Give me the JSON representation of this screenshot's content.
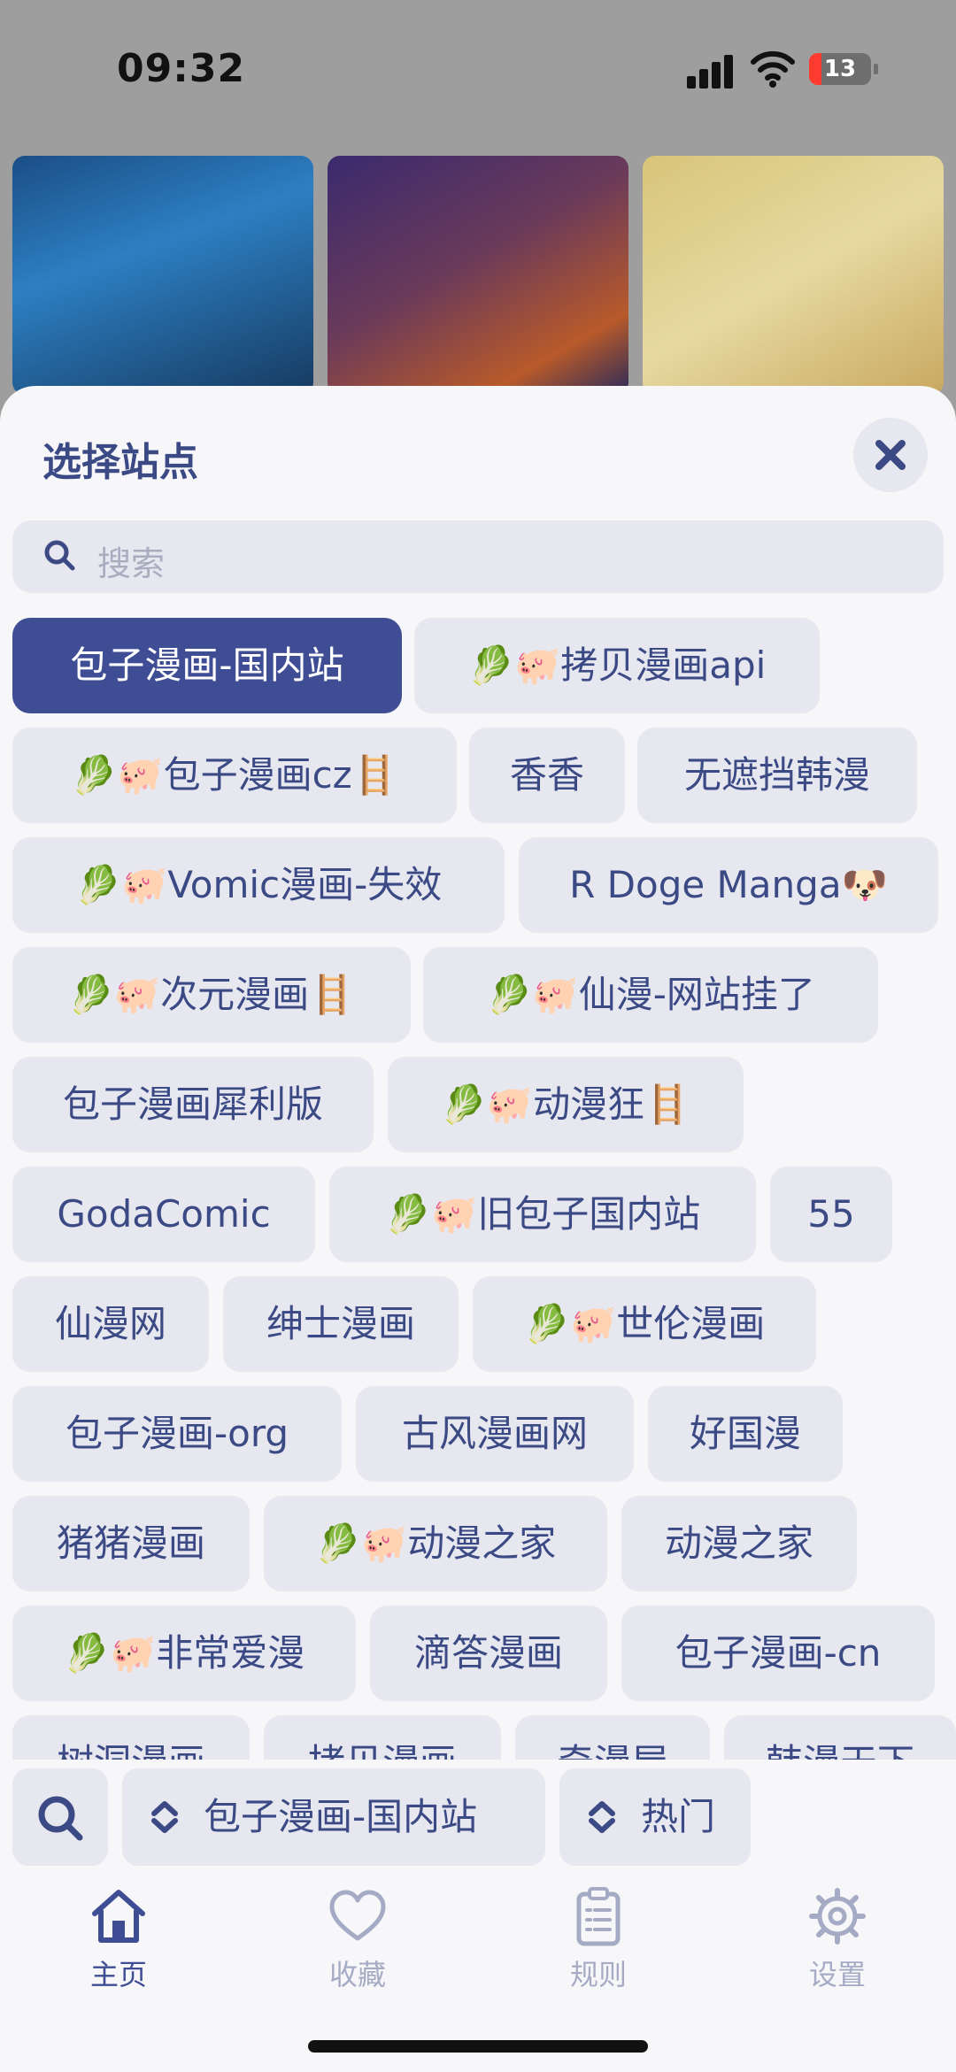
{
  "status": {
    "time": "09:32",
    "battery": "13"
  },
  "sheet": {
    "title": "选择站点",
    "search_placeholder": "搜索",
    "sites": [
      {
        "label": "包子漫画-国内站",
        "selected": true
      },
      {
        "label": "🥬🐖拷贝漫画api"
      },
      {
        "label": "🥬🐖包子漫画cz🪜"
      },
      {
        "label": "香香"
      },
      {
        "label": "无遮挡韩漫"
      },
      {
        "label": "🥬🐖Vomic漫画-失效"
      },
      {
        "label": "R Doge Manga🐶"
      },
      {
        "label": "🥬🐖次元漫画🪜"
      },
      {
        "label": "🥬🐖仙漫-网站挂了"
      },
      {
        "label": "包子漫画犀利版"
      },
      {
        "label": "🥬🐖动漫狂🪜"
      },
      {
        "label": "GodaComic"
      },
      {
        "label": "🥬🐖旧包子国内站"
      },
      {
        "label": "55"
      },
      {
        "label": "仙漫网"
      },
      {
        "label": "绅士漫画"
      },
      {
        "label": "🥬🐖世伦漫画"
      },
      {
        "label": "包子漫画-org"
      },
      {
        "label": "古风漫画网"
      },
      {
        "label": "好国漫"
      },
      {
        "label": "猪猪漫画"
      },
      {
        "label": "🥬🐖动漫之家"
      },
      {
        "label": "动漫之家"
      },
      {
        "label": "🥬🐖非常爱漫"
      },
      {
        "label": "滴答漫画"
      },
      {
        "label": "包子漫画-cn"
      },
      {
        "label": "树洞漫画"
      },
      {
        "label": "拷贝漫画"
      },
      {
        "label": "奇漫屋"
      },
      {
        "label": "韩漫天下"
      }
    ]
  },
  "toolbar": {
    "current_site": "包子漫画-国内站",
    "sort": "热门"
  },
  "tabs": [
    {
      "label": "主页",
      "icon": "home-icon",
      "active": true
    },
    {
      "label": "收藏",
      "icon": "heart-icon"
    },
    {
      "label": "规则",
      "icon": "clipboard-icon"
    },
    {
      "label": "设置",
      "icon": "gear-icon"
    }
  ],
  "colors": {
    "accent": "#3f4d94",
    "chip_bg": "#e6e7ef",
    "inactive": "#a5abc4"
  }
}
